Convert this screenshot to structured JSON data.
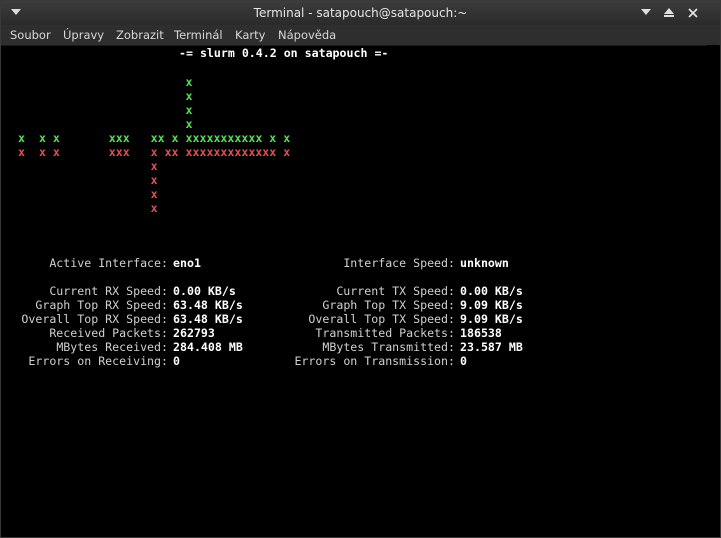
{
  "window": {
    "title": "Terminal - satapouch@satapouch:~"
  },
  "menubar": {
    "items": [
      "Soubor",
      "Úpravy",
      "Zobrazit",
      "Terminál",
      "Karty",
      "Nápověda"
    ]
  },
  "terminal": {
    "header": "-= slurm 0.4.2 on satapouch =-",
    "graph": {
      "green_rows": [
        "                        x",
        "                        x",
        "                        x",
        "                        x",
        "x  x x       xxx   xx x xxxxxxxxxxx x x"
      ],
      "red_rows": [
        "x  x x       xxx   x xx xxxxxxxxxxxxx x",
        "                   x",
        "                   x",
        "                   x",
        "                   x"
      ]
    },
    "stats": {
      "active_interface_label": "Active Interface:",
      "active_interface_value": "eno1",
      "interface_speed_label": "Interface Speed:",
      "interface_speed_value": "unknown",
      "rx": [
        {
          "label": "Current RX Speed:",
          "value": "0.00 KB/s"
        },
        {
          "label": "Graph Top RX Speed:",
          "value": "63.48 KB/s"
        },
        {
          "label": "Overall Top RX Speed:",
          "value": "63.48 KB/s"
        },
        {
          "label": "Received Packets:",
          "value": "262793"
        },
        {
          "label": "MBytes Received:",
          "value": "284.408 MB"
        },
        {
          "label": "Errors on Receiving:",
          "value": "0"
        }
      ],
      "tx": [
        {
          "label": "Current TX Speed:",
          "value": "0.00 KB/s"
        },
        {
          "label": "Graph Top TX Speed:",
          "value": "9.09 KB/s"
        },
        {
          "label": "Overall Top TX Speed:",
          "value": "9.09 KB/s"
        },
        {
          "label": "Transmitted Packets:",
          "value": "186538"
        },
        {
          "label": "MBytes Transmitted:",
          "value": "23.587 MB"
        },
        {
          "label": "Errors on Transmission:",
          "value": "0"
        }
      ]
    }
  },
  "colors": {
    "graph_rx": "#4fe24f",
    "graph_tx": "#e24f4f",
    "background": "#000000"
  }
}
